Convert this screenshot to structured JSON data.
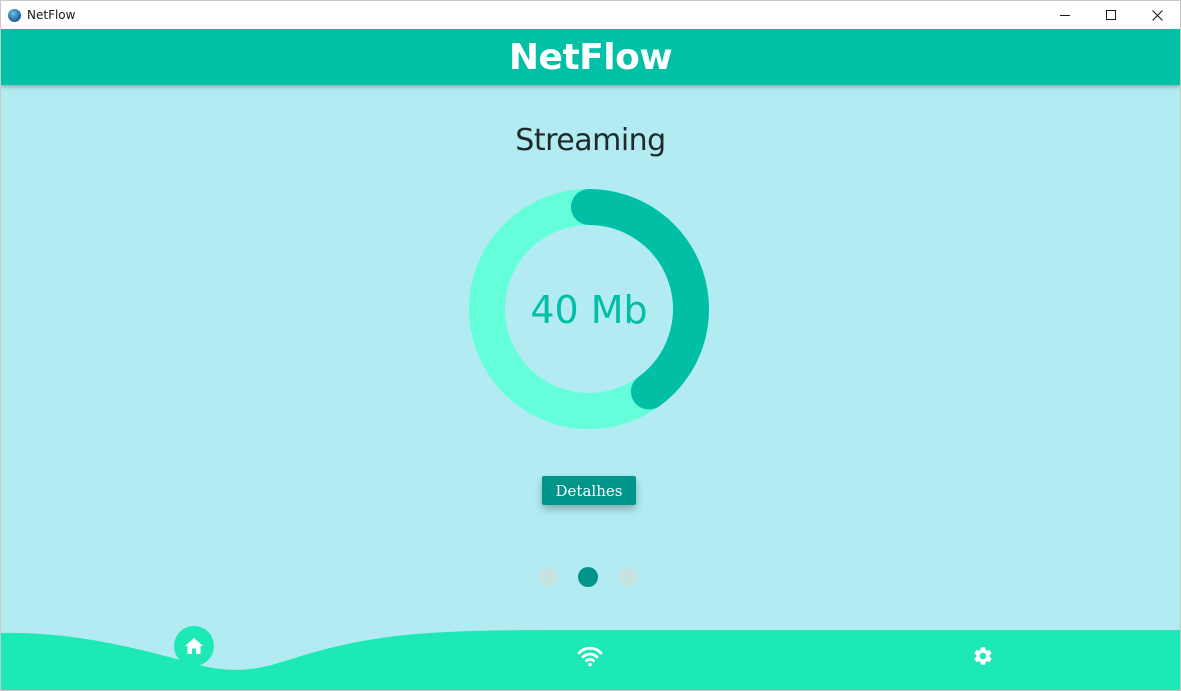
{
  "window": {
    "title": "NetFlow",
    "controls": [
      "minimize-icon",
      "maximize-icon",
      "close-icon"
    ]
  },
  "header": {
    "brand": "NetFlow"
  },
  "main": {
    "section_title": "Streaming",
    "gauge": {
      "value_text": "40 Mb",
      "fraction": 0.4
    },
    "details_button": "Detalhes",
    "pager": {
      "count": 3,
      "active_index": 1
    }
  },
  "bottom_nav": {
    "items": [
      {
        "icon": "home-icon",
        "active": true
      },
      {
        "icon": "wifi-icon",
        "active": false
      },
      {
        "icon": "settings-icon",
        "active": false
      }
    ]
  },
  "colors": {
    "header": "#00c1a6",
    "background": "#b3ebf2",
    "gauge_track": "#64ffda",
    "gauge_fill": "#00bfa5",
    "button": "#00958a",
    "nav_bar": "#1de9b6"
  }
}
